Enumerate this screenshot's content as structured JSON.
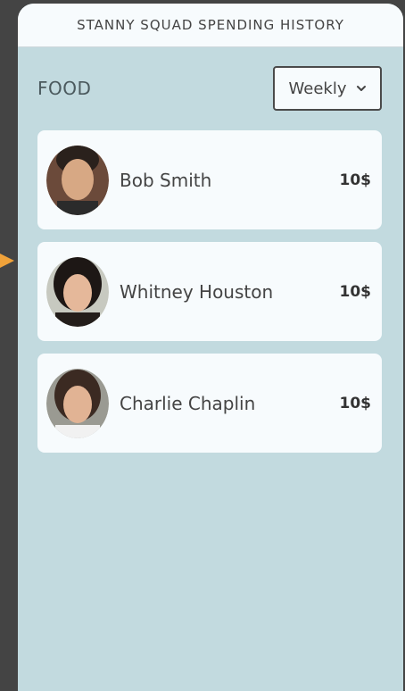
{
  "header": {
    "title": "STANNY SQUAD SPENDING HISTORY"
  },
  "filters": {
    "category": "FOOD",
    "period": "Weekly"
  },
  "people": [
    {
      "name": "Bob Smith",
      "amount": "10$"
    },
    {
      "name": "Whitney Houston",
      "amount": "10$"
    },
    {
      "name": "Charlie Chaplin",
      "amount": "10$"
    }
  ]
}
